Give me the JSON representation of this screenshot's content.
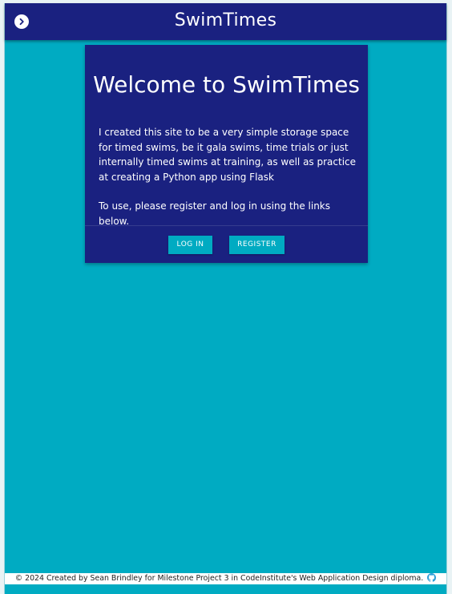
{
  "navbar": {
    "brand": "SwimTimes",
    "toggle_icon": "chevron-right-circle-icon"
  },
  "card": {
    "title": "Welcome to SwimTimes",
    "paragraph1": "I created this site to be a very simple storage space for timed swims, be it gala swims, time trials or just internally timed swims at training, as well as practice at creating a Python app using Flask",
    "paragraph2": "To use, please register and log in using the links below.",
    "login_label": "LOG IN",
    "register_label": "REGISTER"
  },
  "footer": {
    "text": "© 2024 Created by Sean Brindley for Milestone Project 3 in CodeInstitute's Web Application Design diploma.",
    "icon": "github-icon"
  },
  "colors": {
    "navy": "#1a2180",
    "teal": "#00abc2",
    "white": "#ffffff"
  }
}
